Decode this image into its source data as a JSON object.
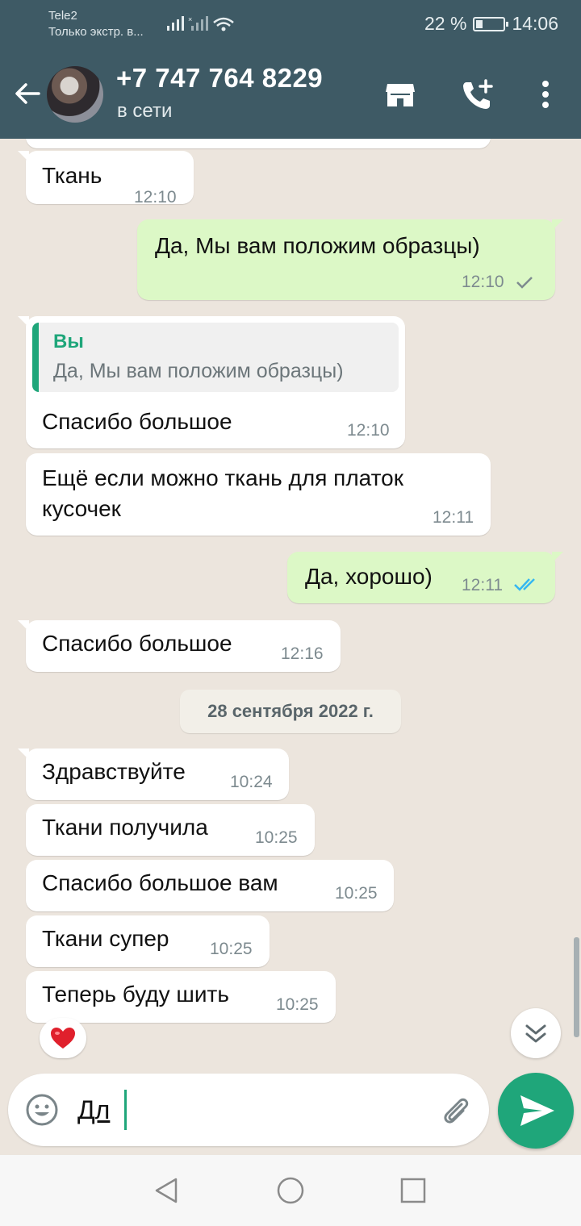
{
  "status_bar": {
    "carrier": "Tele2",
    "carrier_sub": "Только экстр. в...",
    "battery": "22 %",
    "time": "14:06"
  },
  "header": {
    "contact_name": "+7 747 764 8229",
    "contact_status": "в сети"
  },
  "messages": [
    {
      "dir": "in",
      "text": "Ткань",
      "time": "12:10"
    },
    {
      "dir": "out",
      "text": "Да, Мы вам положим образцы)",
      "time": "12:10",
      "ticks": "sent"
    },
    {
      "dir": "in",
      "reply_author": "Вы",
      "reply_text": "Да, Мы вам положим образцы)",
      "text": "Спасибо большое",
      "time": "12:10"
    },
    {
      "dir": "in",
      "text_line1": "Ещё если можно ткань для платок",
      "text_line2": "кусочек",
      "time": "12:11"
    },
    {
      "dir": "out",
      "text": "Да, хорошо)",
      "time": "12:11",
      "ticks": "read"
    },
    {
      "dir": "in",
      "text": "Спасибо большое",
      "time": "12:16"
    },
    {
      "dir": "in",
      "text": "Здравствуйте",
      "time": "10:24"
    },
    {
      "dir": "in",
      "text": "Ткани получила",
      "time": "10:25"
    },
    {
      "dir": "in",
      "text": "Спасибо большое вам",
      "time": "10:25"
    },
    {
      "dir": "in",
      "text": "Ткани супер",
      "time": "10:25"
    },
    {
      "dir": "in",
      "text": "Теперь буду шить",
      "time": "10:25"
    }
  ],
  "date_separator": "28 сентября 2022 г.",
  "reaction": "❤️",
  "composer": {
    "value": "Дл"
  },
  "colors": {
    "header_bg": "#3e5a65",
    "chat_bg": "#ece5dd",
    "outgoing_bubble": "#dcf8c6",
    "accent": "#1fa67a",
    "read_tick": "#34b7f1"
  }
}
